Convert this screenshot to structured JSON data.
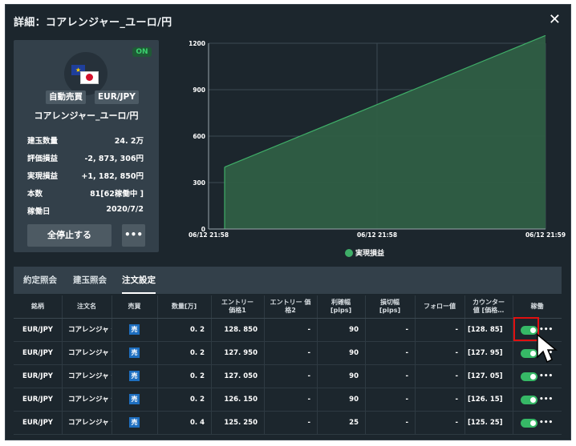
{
  "title": "詳細：コアレンジャー_ユーロ/円",
  "close_label": "✕",
  "card": {
    "status_badge": "ON",
    "tag_auto": "自動売買",
    "tag_pair": "EUR/JPY",
    "name": "コアレンジャー_ユーロ/円",
    "stats": [
      {
        "label": "建玉数量",
        "value": "24. 2万"
      },
      {
        "label": "評価損益",
        "value": "-2, 873, 306円"
      },
      {
        "label": "実現損益",
        "value": "+1, 182, 850円"
      },
      {
        "label": "本数",
        "value": "81[62稼働中 ]"
      },
      {
        "label": "稼働日",
        "value": "2020/7/2"
      }
    ],
    "stop_all_label": "全停止する",
    "more_label": "•••"
  },
  "chart_data": {
    "type": "area",
    "x_ticks": [
      "06/12 21:58",
      "06/12 21:58",
      "06/12 21:59"
    ],
    "y_ticks": [
      0,
      300,
      600,
      900,
      1200
    ],
    "ylim": [
      0,
      1200
    ],
    "series": [
      {
        "name": "実現損益",
        "color": "#2f5e45",
        "x": [
          0.0,
          1.0
        ],
        "values": [
          400,
          1250
        ]
      }
    ],
    "grid": true,
    "legend": "bottom-center"
  },
  "tabs": [
    {
      "label": "約定照会",
      "active": false
    },
    {
      "label": "建玉照会",
      "active": false
    },
    {
      "label": "注文設定",
      "active": true
    }
  ],
  "table": {
    "headers": [
      "銘柄",
      "注文名",
      "売買",
      "数量[万]",
      "エントリー\n価格1",
      "エントリー 価\n格2",
      "利確幅\n[pips]",
      "損切幅\n[pips]",
      "フォロー値",
      "カウンター\n値 [価格…",
      "稼働"
    ],
    "rows": [
      {
        "symbol": "EUR/JPY",
        "name": "コアレンジャ・",
        "side": "売",
        "qty": "0. 2",
        "entry1": "128. 850",
        "entry2": "-",
        "tp": "90",
        "sl": "-",
        "follow": "-",
        "counter": "[128. 85]",
        "active": true
      },
      {
        "symbol": "EUR/JPY",
        "name": "コアレンジャ・",
        "side": "売",
        "qty": "0. 2",
        "entry1": "127. 950",
        "entry2": "-",
        "tp": "90",
        "sl": "-",
        "follow": "-",
        "counter": "[127. 95]",
        "active": true
      },
      {
        "symbol": "EUR/JPY",
        "name": "コアレンジャ・",
        "side": "売",
        "qty": "0. 2",
        "entry1": "127. 050",
        "entry2": "-",
        "tp": "90",
        "sl": "-",
        "follow": "-",
        "counter": "[127. 05]",
        "active": true
      },
      {
        "symbol": "EUR/JPY",
        "name": "コアレンジャ・",
        "side": "売",
        "qty": "0. 2",
        "entry1": "126. 150",
        "entry2": "-",
        "tp": "90",
        "sl": "-",
        "follow": "-",
        "counter": "[126. 15]",
        "active": true
      },
      {
        "symbol": "EUR/JPY",
        "name": "コアレンジャ・",
        "side": "売",
        "qty": "0. 4",
        "entry1": "125. 250",
        "entry2": "-",
        "tp": "25",
        "sl": "-",
        "follow": "-",
        "counter": "[125. 25]",
        "active": true
      }
    ],
    "more_label": "•••"
  }
}
